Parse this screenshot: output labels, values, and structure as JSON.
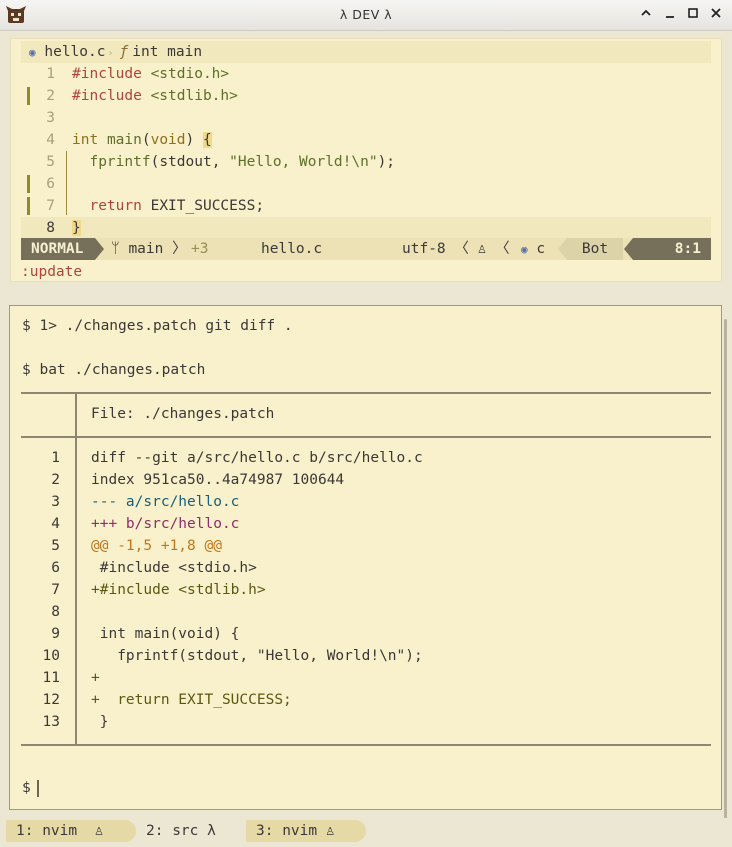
{
  "window": {
    "title": "λ DEV λ"
  },
  "editor": {
    "winbar": {
      "file": "hello.c",
      "symbol": "int main"
    },
    "lines": [
      {
        "n": "1",
        "segs": [
          [
            "pre",
            "#include"
          ],
          [
            "",
            " "
          ],
          [
            "str",
            "<stdio.h>"
          ]
        ]
      },
      {
        "n": "2",
        "segs": [
          [
            "pre",
            "#include"
          ],
          [
            "",
            " "
          ],
          [
            "str",
            "<stdlib.h>"
          ]
        ]
      },
      {
        "n": "3",
        "segs": []
      },
      {
        "n": "4",
        "segs": [
          [
            "type",
            "int"
          ],
          [
            "",
            " "
          ],
          [
            "fn",
            "main"
          ],
          [
            "",
            "("
          ],
          [
            "type",
            "void"
          ],
          [
            "",
            ") "
          ],
          [
            "brace",
            "{"
          ]
        ]
      },
      {
        "n": "5",
        "segs": [
          [
            "",
            "  "
          ],
          [
            "fn",
            "fprintf"
          ],
          [
            "",
            "("
          ],
          [
            "",
            "stdout"
          ],
          [
            "",
            ", "
          ],
          [
            "str",
            "\"Hello, World!\\n\""
          ],
          [
            "",
            ");"
          ]
        ]
      },
      {
        "n": "6",
        "segs": []
      },
      {
        "n": "7",
        "segs": [
          [
            "",
            "  "
          ],
          [
            "key",
            "return"
          ],
          [
            "",
            " EXIT_SUCCESS;"
          ]
        ]
      },
      {
        "n": "8",
        "segs": [
          [
            "brace",
            "}"
          ]
        ]
      }
    ],
    "status": {
      "mode": "NORMAL",
      "branch": "main",
      "diff": "+3",
      "file": "hello.c",
      "encoding": "utf-8",
      "filetype": "c",
      "scroll": "Bot",
      "position": "8:1"
    },
    "cmdline": ":update"
  },
  "terminal": {
    "cmd1": "$ 1> ./changes.patch git diff .",
    "cmd2": "$ bat ./changes.patch",
    "file_header": "File: ./changes.patch",
    "diff": [
      {
        "n": "1",
        "t": "diff --git a/src/hello.c b/src/hello.c",
        "k": ""
      },
      {
        "n": "2",
        "t": "index 951ca50..4a74987 100644",
        "k": ""
      },
      {
        "n": "3",
        "t": "--- a/src/hello.c",
        "k": "minus"
      },
      {
        "n": "4",
        "t": "+++ b/src/hello.c",
        "k": "plus"
      },
      {
        "n": "5",
        "t": "@@ -1,5 +1,8 @@",
        "k": "hunk"
      },
      {
        "n": "6",
        "t": " #include <stdio.h>",
        "k": ""
      },
      {
        "n": "7",
        "t": "+#include <stdlib.h>",
        "k": "add"
      },
      {
        "n": "8",
        "t": "",
        "k": ""
      },
      {
        "n": "9",
        "t": " int main(void) {",
        "k": ""
      },
      {
        "n": "10",
        "t": "   fprintf(stdout, \"Hello, World!\\n\");",
        "k": ""
      },
      {
        "n": "11",
        "t": "+",
        "k": "add"
      },
      {
        "n": "12",
        "t": "+  return EXIT_SUCCESS;",
        "k": "add"
      },
      {
        "n": "13",
        "t": " }",
        "k": ""
      }
    ],
    "prompt": "$"
  },
  "tabs": [
    {
      "label": "1: nvim  ♙",
      "active": false
    },
    {
      "label": "2: src λ",
      "active": true
    },
    {
      "label": "3: nvim ♙",
      "active": false
    }
  ],
  "colors": {
    "terminal_border": "#48d148",
    "editor_bg": "#f9f1cc",
    "accent": "#76705a"
  }
}
